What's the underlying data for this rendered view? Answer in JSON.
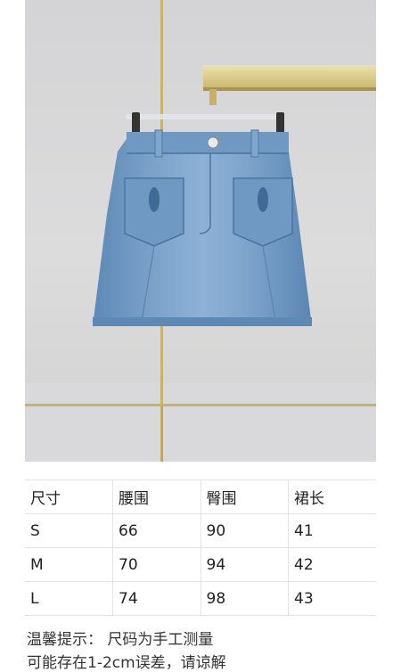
{
  "product_photo": {
    "subject": "denim-mini-skirt-on-hanger"
  },
  "size_table": {
    "headers": [
      "尺寸",
      "腰围",
      "臀围",
      "裙长"
    ],
    "rows": [
      [
        "S",
        "66",
        "90",
        "41"
      ],
      [
        "M",
        "70",
        "94",
        "42"
      ],
      [
        "L",
        "74",
        "98",
        "43"
      ]
    ]
  },
  "note": {
    "line1": "温馨提示：  尺码为手工测量",
    "line2": "可能存在1-2cm误差，请谅解"
  }
}
